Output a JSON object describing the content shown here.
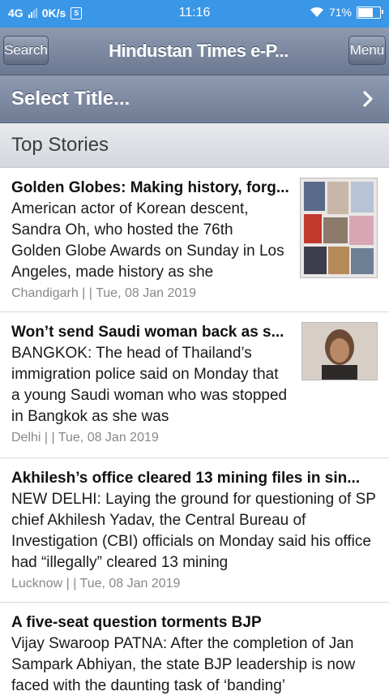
{
  "status": {
    "network": "4G",
    "speed": "0K/s",
    "time": "11:16",
    "battery": "71%",
    "battery_level": 0.71
  },
  "header": {
    "search_label": "Search",
    "title": "Hindustan Times e-P...",
    "menu_label": "Menu"
  },
  "select": {
    "label": "Select Title..."
  },
  "section": {
    "label": "Top Stories"
  },
  "stories": [
    {
      "title": "Golden Globes: Making history, forg...",
      "body": "American actor of Korean descent, Sandra Oh, who hosted the 76th Golden Globe Awards on Sunday in Los Angeles, made history as she",
      "meta": "Chandigarh | | Tue, 08 Jan 2019",
      "thumb": "collage"
    },
    {
      "title": "Won’t send Saudi woman back as s...",
      "body": "BANGKOK: The head of Thailand’s immigration police said on Monday that a young Saudi woman who was stopped in Bangkok as she was",
      "meta": "Delhi | | Tue, 08 Jan 2019",
      "thumb": "portrait"
    },
    {
      "title": "Akhilesh’s office cleared 13 mining files in sin...",
      "body": "NEW DELHI: Laying the ground for questioning of SP chief Akhilesh Yadav, the Central Bureau of Investigation (CBI) officials on Monday said his office had “illegally” cleared 13 mining",
      "meta": "Lucknow | | Tue, 08 Jan 2019",
      "thumb": ""
    },
    {
      "title": "A five-seat question torments BJP",
      "body": "Vijay Swaroop PATNA: After the completion of Jan Sampark Abhiyan, the state BJP leadership is now faced with the daunting task of ‘banding’",
      "meta": "",
      "thumb": ""
    }
  ]
}
